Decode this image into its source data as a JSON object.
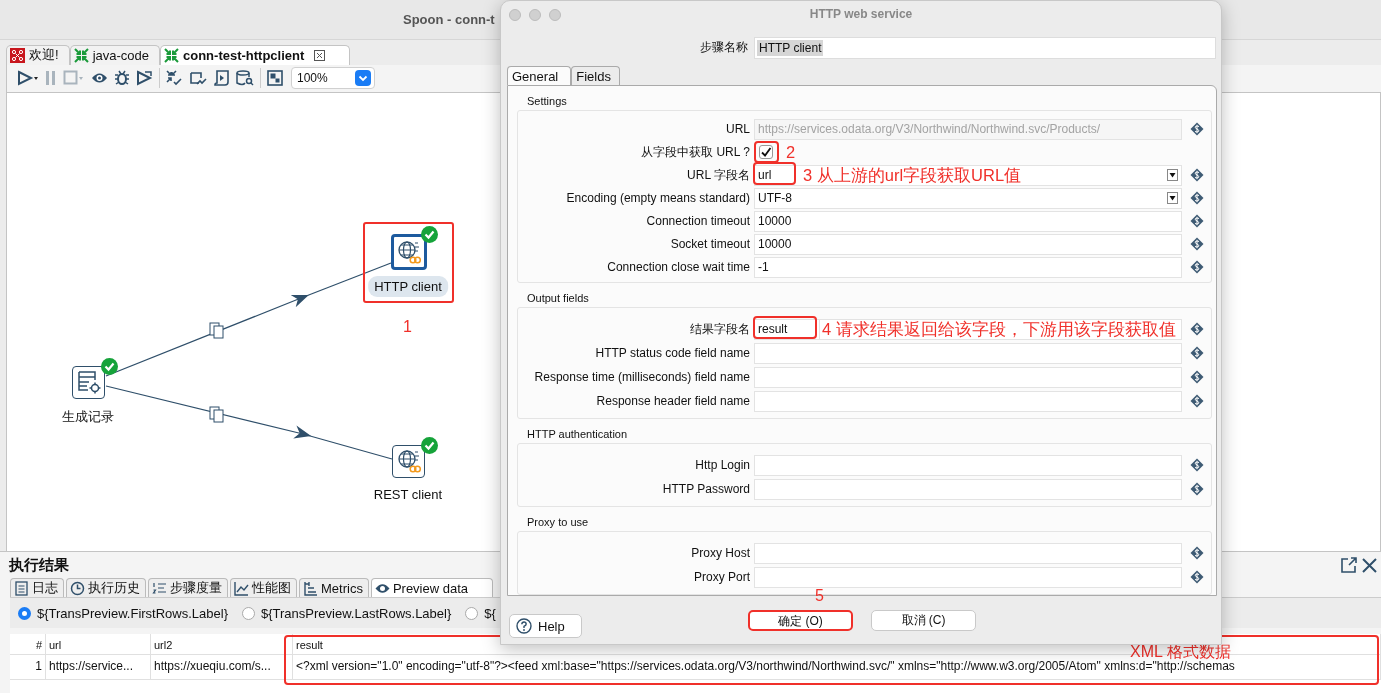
{
  "window": {
    "title": "Spoon - conn-t"
  },
  "tabs": [
    {
      "label": "欢迎!",
      "kind": "welcome",
      "selected": false,
      "closable": false
    },
    {
      "label": "java-code",
      "kind": "trans",
      "selected": false,
      "closable": false
    },
    {
      "label": "conn-test-httpclient",
      "kind": "trans",
      "selected": true,
      "closable": true
    }
  ],
  "toolbar": {
    "zoom": "100%"
  },
  "canvas": {
    "nodes": [
      {
        "label": "生成记录",
        "kind": "generator",
        "ok": true,
        "selected": false
      },
      {
        "label": "HTTP client",
        "kind": "http",
        "ok": true,
        "selected": true,
        "note": "1"
      },
      {
        "label": "REST client",
        "kind": "rest",
        "ok": true,
        "selected": false
      }
    ]
  },
  "results": {
    "title": "执行结果",
    "tabs": [
      {
        "label": "日志",
        "kind": "log",
        "selected": false
      },
      {
        "label": "执行历史",
        "kind": "history",
        "selected": false
      },
      {
        "label": "步骤度量",
        "kind": "steps",
        "selected": false
      },
      {
        "label": "性能图",
        "kind": "perf",
        "selected": false
      },
      {
        "label": "Metrics",
        "kind": "metrics",
        "selected": false
      },
      {
        "label": "Preview data",
        "kind": "preview",
        "selected": true
      }
    ],
    "radios": [
      {
        "label": "${TransPreview.FirstRows.Label}",
        "selected": true
      },
      {
        "label": "${TransPreview.LastRows.Label}",
        "selected": false
      },
      {
        "label": "${",
        "selected": false
      }
    ],
    "table": {
      "columns": [
        {
          "label": "#"
        },
        {
          "label": "url"
        },
        {
          "label": "url2"
        },
        {
          "label": "result",
          "note": "XML 格式数据"
        }
      ],
      "rows": [
        [
          "1",
          "https://service...",
          "https://xueqiu.com/s...",
          "<?xml version=\"1.0\" encoding=\"utf-8\"?><feed xml:base=\"https://services.odata.org/V3/northwind/Northwind.svc/\" xmlns=\"http://www.w3.org/2005/Atom\" xmlns:d=\"http://schemas"
        ]
      ]
    }
  },
  "dialog": {
    "title": "HTTP web service",
    "step_name_label": "步骤名称",
    "step_name": "HTTP client",
    "tabs": [
      {
        "label": "General",
        "selected": true
      },
      {
        "label": "Fields",
        "selected": false
      }
    ],
    "groups": [
      {
        "title": "Settings",
        "rows": [
          {
            "label": "URL",
            "kind": "text",
            "value": "https://services.odata.org/V3/Northwind/Northwind.svc/Products/",
            "disabled": true
          },
          {
            "label": "从字段中获取 URL ?",
            "kind": "checkbox",
            "checked": true,
            "note": "2"
          },
          {
            "label": "URL 字段名",
            "kind": "combo",
            "value": "url",
            "note": "3 从上游的url字段获取URL值"
          },
          {
            "label": "Encoding (empty means standard)",
            "kind": "combo",
            "value": "UTF-8"
          },
          {
            "label": "Connection timeout",
            "kind": "text",
            "value": "10000"
          },
          {
            "label": "Socket timeout",
            "kind": "text",
            "value": "10000"
          },
          {
            "label": "Connection close wait time",
            "kind": "text",
            "value": "-1"
          }
        ]
      },
      {
        "title": "Output fields",
        "rows": [
          {
            "label": "结果字段名",
            "kind": "text",
            "value": "result",
            "note": "4 请求结果返回给该字段，下游用该字段获取值"
          },
          {
            "label": "HTTP status code field name",
            "kind": "text"
          },
          {
            "label": "Response time (milliseconds) field name",
            "kind": "text"
          },
          {
            "label": "Response header field name",
            "kind": "text"
          }
        ]
      },
      {
        "title": "HTTP authentication",
        "rows": [
          {
            "label": "Http Login",
            "kind": "text"
          },
          {
            "label": "HTTP Password",
            "kind": "text"
          }
        ]
      },
      {
        "title": "Proxy to use",
        "rows": [
          {
            "label": "Proxy Host",
            "kind": "text"
          },
          {
            "label": "Proxy Port",
            "kind": "text"
          }
        ]
      }
    ],
    "buttons": [
      {
        "label": "Help",
        "kind": "help"
      },
      {
        "label": "确定 (O)",
        "kind": "ok",
        "note": "5"
      },
      {
        "label": "取消 (C)",
        "kind": "cancel"
      }
    ]
  }
}
